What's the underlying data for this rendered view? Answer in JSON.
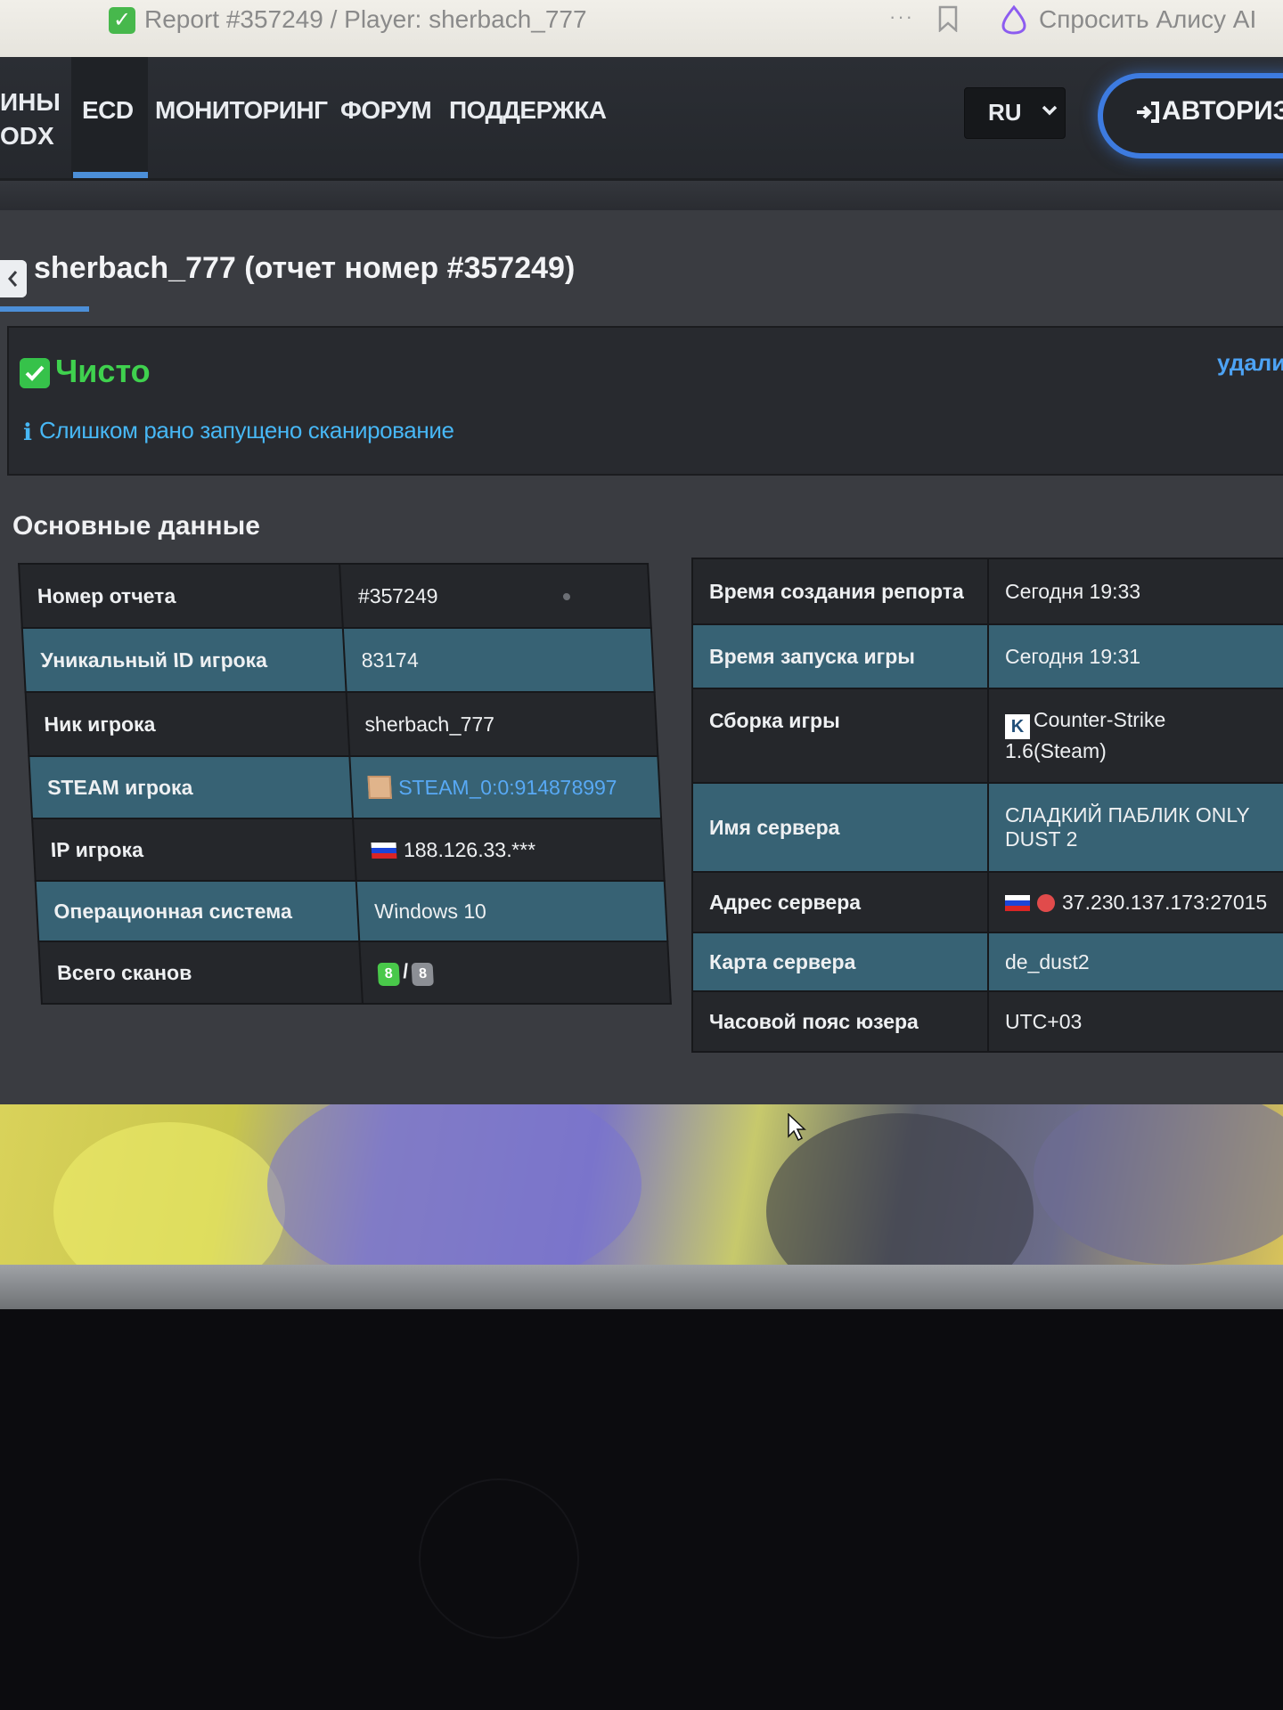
{
  "browser": {
    "tab_title": "Report #357249 / Player: sherbach_777",
    "more_glyph": "···",
    "alice_label": "Спросить Алису AI"
  },
  "nav": {
    "brand_fragment_line1": "ИНЫ",
    "brand_fragment_line2": "ODX",
    "items": [
      {
        "label": "ECD"
      },
      {
        "label": "МОНИТОРИНГ"
      },
      {
        "label": "ФОРУМ"
      },
      {
        "label": "ПОДДЕРЖКА"
      }
    ],
    "active_item": "ECD",
    "language": "RU",
    "login_label": "АВТОРИЗ"
  },
  "page": {
    "title": "sherbach_777 (отчет номер #357249)",
    "status_label": "Чисто",
    "delete_label": "удалит",
    "info_icon": "ℹ",
    "info_text": "Слишком рано запущено сканирование",
    "section_title": "Основные данные"
  },
  "left_table": [
    {
      "key": "Номер отчета",
      "value": "#357249"
    },
    {
      "key": "Уникальный ID игрока",
      "value": "83174"
    },
    {
      "key": "Ник игрока",
      "value": "sherbach_777"
    },
    {
      "key": "STEAM игрока",
      "value": "STEAM_0:0:914878997"
    },
    {
      "key": "IP игрока",
      "value": "188.126.33.***"
    },
    {
      "key": "Операционная система",
      "value": "Windows 10"
    },
    {
      "key": "Всего сканов",
      "value_a": "8",
      "sep": "/",
      "value_b": "8"
    }
  ],
  "right_table": [
    {
      "key": "Время создания репорта",
      "value": "Сегодня 19:33"
    },
    {
      "key": "Время запуска игры",
      "value": "Сегодня 19:31"
    },
    {
      "key": "Сборка игры",
      "line1": "Counter-Strike",
      "line2": "1.6(Steam)"
    },
    {
      "key": "Имя сервера",
      "line1": "СЛАДКИЙ ПАБЛИК ONLY",
      "line2": "DUST 2"
    },
    {
      "key": "Адрес сервера",
      "value": "37.230.137.173:27015"
    },
    {
      "key": "Карта сервера",
      "value": "de_dust2"
    },
    {
      "key": "Часовой пояс юзера",
      "value": "UTC+03"
    }
  ],
  "colors": {
    "accent_blue": "#4c8fd8",
    "status_green": "#3fd14e",
    "info_cyan": "#47b7f5",
    "row_teal": "#376274",
    "row_dark": "#25272b"
  },
  "icons": {
    "tab": "check-square-icon",
    "bookmark": "bookmark-icon",
    "alice": "alice-ring-icon",
    "language": "chevron-down-icon",
    "login": "login-arrow-icon",
    "back": "chevron-left-icon",
    "status": "check-square-icon"
  }
}
